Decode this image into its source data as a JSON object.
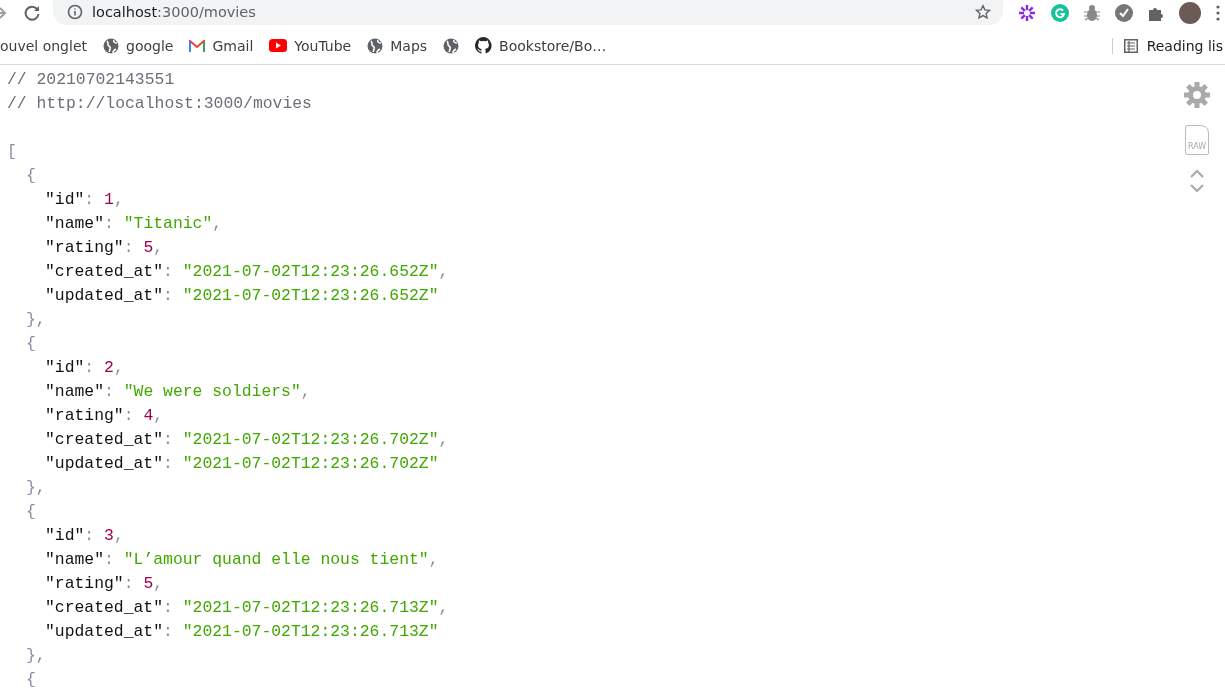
{
  "browser": {
    "url_host": "localhost",
    "url_path": ":3000/movies",
    "bookmarks": [
      {
        "label": "ouvel onglet"
      },
      {
        "label": "google"
      },
      {
        "label": "Gmail"
      },
      {
        "label": "YouTube"
      },
      {
        "label": "Maps"
      },
      {
        "label": "Bookstore/Bo…"
      }
    ],
    "reading_list": "Reading lis"
  },
  "json_view": {
    "comments": [
      "// 20210702143551",
      "// http://localhost:3000/movies"
    ],
    "open": "[",
    "objects": [
      {
        "open": "{",
        "close": "},",
        "properties": [
          {
            "key": "\"id\"",
            "value": "1",
            "kind": "number"
          },
          {
            "key": "\"name\"",
            "value": "\"Titanic\"",
            "kind": "string"
          },
          {
            "key": "\"rating\"",
            "value": "5",
            "kind": "number"
          },
          {
            "key": "\"created_at\"",
            "value": "\"2021-07-02T12:23:26.652Z\"",
            "kind": "string"
          },
          {
            "key": "\"updated_at\"",
            "value": "\"2021-07-02T12:23:26.652Z\"",
            "kind": "string"
          }
        ]
      },
      {
        "open": "{",
        "close": "},",
        "properties": [
          {
            "key": "\"id\"",
            "value": "2",
            "kind": "number"
          },
          {
            "key": "\"name\"",
            "value": "\"We were soldiers\"",
            "kind": "string"
          },
          {
            "key": "\"rating\"",
            "value": "4",
            "kind": "number"
          },
          {
            "key": "\"created_at\"",
            "value": "\"2021-07-02T12:23:26.702Z\"",
            "kind": "string"
          },
          {
            "key": "\"updated_at\"",
            "value": "\"2021-07-02T12:23:26.702Z\"",
            "kind": "string"
          }
        ]
      },
      {
        "open": "{",
        "close": "},",
        "properties": [
          {
            "key": "\"id\"",
            "value": "3",
            "kind": "number"
          },
          {
            "key": "\"name\"",
            "value": "\"L’amour quand elle nous tient\"",
            "kind": "string"
          },
          {
            "key": "\"rating\"",
            "value": "5",
            "kind": "number"
          },
          {
            "key": "\"created_at\"",
            "value": "\"2021-07-02T12:23:26.713Z\"",
            "kind": "string"
          },
          {
            "key": "\"updated_at\"",
            "value": "\"2021-07-02T12:23:26.713Z\"",
            "kind": "string"
          }
        ]
      },
      {
        "open": "{"
      }
    ],
    "colon": ":",
    "comma": ",",
    "raw_label": "RAW"
  }
}
